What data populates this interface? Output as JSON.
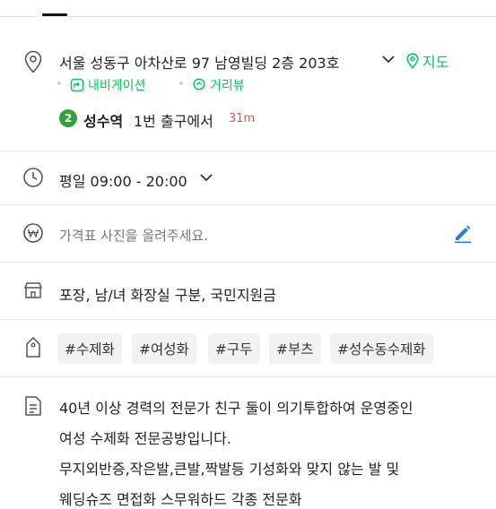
{
  "address": {
    "text": "서울 성동구 아차산로 97 남영빌딩 2층 203호",
    "map_label": "지도",
    "navigation_label": "내비게이션",
    "street_view_label": "거리뷰",
    "subway_line": "2",
    "station": "성수역",
    "exit_text": "1번 출구에서",
    "distance": "31m"
  },
  "hours": {
    "text": "평일 09:00 - 20:00"
  },
  "price": {
    "text": "가격표 사진을 올려주세요."
  },
  "facilities": {
    "text": "포장, 남/녀 화장실 구분, 국민지원금"
  },
  "tags": [
    "#수제화",
    "#여성화",
    "#구두",
    "#부츠",
    "#성수동수제화"
  ],
  "description": {
    "lines": [
      "40년 이상 경력의 전문가 친구 둘이 의기투합하여 운영중인",
      "여성 수제화 전문공방입니다.",
      "무지외반증,작은발,큰발,짝발등 기성화와 맞지 않는 발 및",
      "웨딩슈즈 면접화 스무워하드 각종 전문화"
    ]
  },
  "colors": {
    "accent_green": "#03c75a",
    "distance_red": "#e05050",
    "edit_blue": "#2a7de1"
  }
}
